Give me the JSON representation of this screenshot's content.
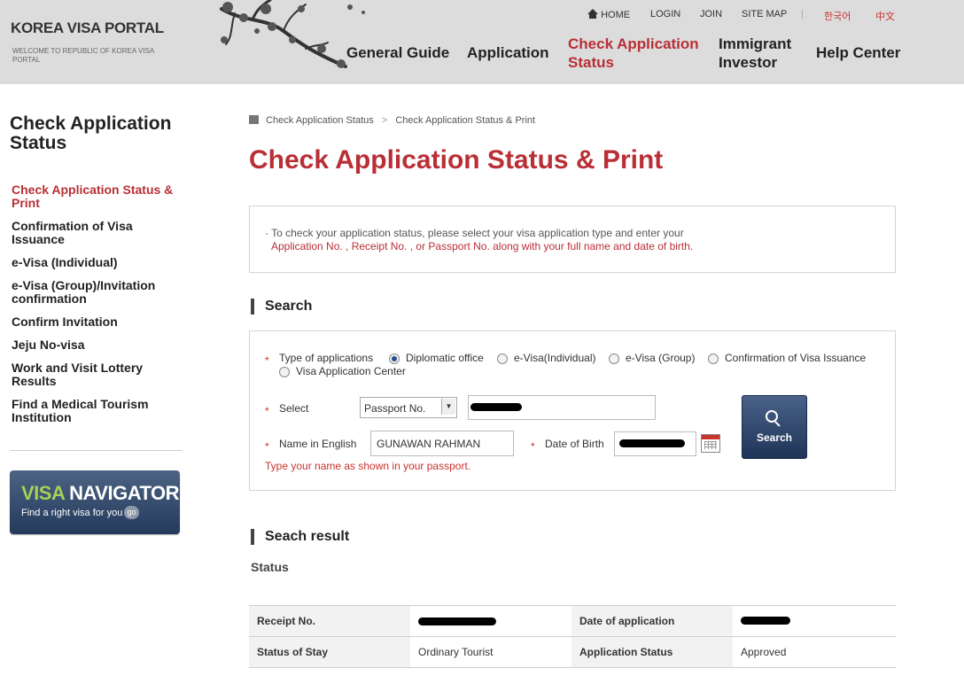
{
  "header": {
    "logo_title": "KOREA VISA PORTAL",
    "logo_sub": "WELCOME TO REPUBLIC OF KOREA VISA PORTAL",
    "util": {
      "home": "HOME",
      "login": "LOGIN",
      "join": "JOIN",
      "sitemap": "SITE MAP",
      "sep": "|",
      "lang_ko": "한국어",
      "lang_zh": "中文"
    },
    "gnb": {
      "general_guide": "General Guide",
      "application": "Application",
      "check_status_1": "Check Application",
      "check_status_2": "Status",
      "immigrant_1": "Immigrant",
      "immigrant_2": "Investor",
      "help_center": "Help Center"
    }
  },
  "sidebar": {
    "title_1": "Check Application",
    "title_2": "Status",
    "items": [
      {
        "l1": "Check Application Status &",
        "l2": "Print"
      },
      {
        "l1": "Confirmation of Visa",
        "l2": "Issuance"
      },
      {
        "l1": "e-Visa (Individual)",
        "l2": ""
      },
      {
        "l1": "e-Visa (Group)/Invitation",
        "l2": "confirmation"
      },
      {
        "l1": "Confirm Invitation",
        "l2": ""
      },
      {
        "l1": "Jeju No-visa",
        "l2": ""
      },
      {
        "l1": "Work and Visit Lottery",
        "l2": "Results"
      },
      {
        "l1": "Find a Medical Tourism",
        "l2": "Institution"
      }
    ],
    "visa_navigator": {
      "title_a": "VISA",
      "title_b": "NAVIGATOR",
      "subtitle": "Find a right visa for you",
      "go": "go"
    }
  },
  "breadcrumb": {
    "level1": "Check Application Status",
    "arrow": ">",
    "level2": "Check Application Status & Print"
  },
  "main": {
    "page_title": "Check Application Status & Print",
    "notice_line1": "· To check your application status, please select your visa application type and enter your",
    "notice_line2": "Application No. , Receipt No. , or Passport No. along with your full name and date of birth."
  },
  "search": {
    "section_title": "Search",
    "star": "*",
    "type_label": "Type of applications",
    "types": [
      "Diplomatic office",
      "e-Visa(Individual)",
      "e-Visa (Group)",
      "Confirmation of Visa Issuance",
      "Visa Application Center"
    ],
    "selected_type": "Diplomatic office",
    "select_label": "Select",
    "select_value": "Passport No.",
    "select_arrow": "▼",
    "name_label": "Name in English",
    "name_value": "GUNAWAN RAHMAN",
    "dob_label": "Date of Birth",
    "hint": "Type your name as shown in your passport.",
    "button_label": "Search"
  },
  "result": {
    "section_title": "Seach result",
    "status_label": "Status",
    "receipt_label": "Receipt No.",
    "date_label": "Date of application",
    "stay_label": "Status of Stay",
    "stay_value": "Ordinary Tourist",
    "app_status_label": "Application Status",
    "app_status_value": "Approved"
  },
  "colors": {
    "accent_red": "#b92f35",
    "header_bg": "#dcdcdc",
    "navy": "#243a5c"
  }
}
